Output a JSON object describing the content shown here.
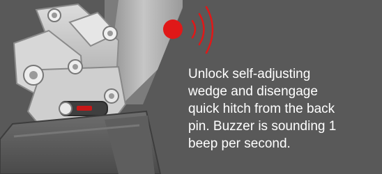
{
  "instruction": {
    "text": "Unlock self-adjusting\nwedge and disengage\nquick hitch from the back\npin. Buzzer is sounding 1\nbeep per second."
  },
  "colors": {
    "background": "#595959",
    "buzzer": "#e01818",
    "text": "#ffffff"
  },
  "icons": {
    "buzzer": "buzzer-sound-icon",
    "illustration": "quick-hitch-illustration"
  }
}
